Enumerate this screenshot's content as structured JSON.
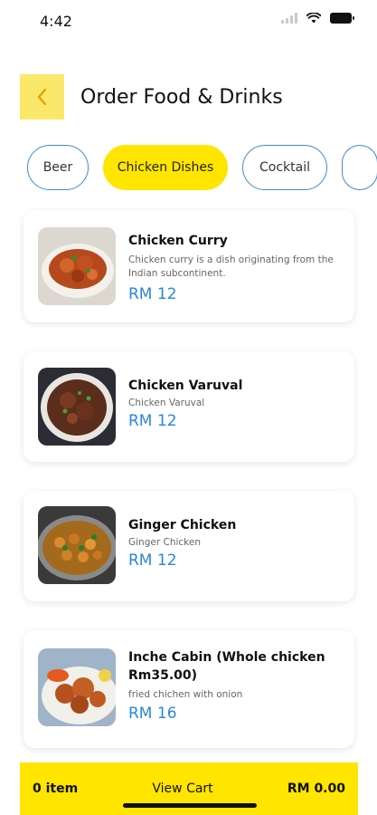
{
  "status_bar": {
    "time": "4:42",
    "icons": [
      "signal-icon",
      "wifi-icon",
      "battery-icon"
    ]
  },
  "header": {
    "back_icon": "chevron-left-icon",
    "title": "Order Food & Drinks"
  },
  "categories": [
    {
      "label": "Beer",
      "active": false
    },
    {
      "label": "Chicken Dishes",
      "active": true
    },
    {
      "label": "Cocktail",
      "active": false
    },
    {
      "label": "",
      "active": false
    }
  ],
  "menu_items": [
    {
      "name": "Chicken Curry",
      "description": "Chicken curry is a dish originating from the Indian subcontinent.",
      "price": "RM 12",
      "image": "chicken-curry-photo"
    },
    {
      "name": "Chicken Varuval",
      "description": "Chicken Varuval",
      "price": "RM 12",
      "image": "chicken-varuval-photo"
    },
    {
      "name": "Ginger Chicken",
      "description": "Ginger Chicken",
      "price": "RM 12",
      "image": "ginger-chicken-photo"
    },
    {
      "name": "Inche Cabin (Whole chicken Rm35.00)",
      "description": "fried chichen with onion",
      "price": "RM 16",
      "image": "inche-cabin-photo"
    }
  ],
  "cart": {
    "items": "0 item",
    "view_label": "View Cart",
    "total": "RM 0.00"
  },
  "colors": {
    "accent_yellow": "#ffe500",
    "back_button": "#fbe86b",
    "price_blue": "#2a86d9",
    "chip_border": "#3d8ad9"
  }
}
